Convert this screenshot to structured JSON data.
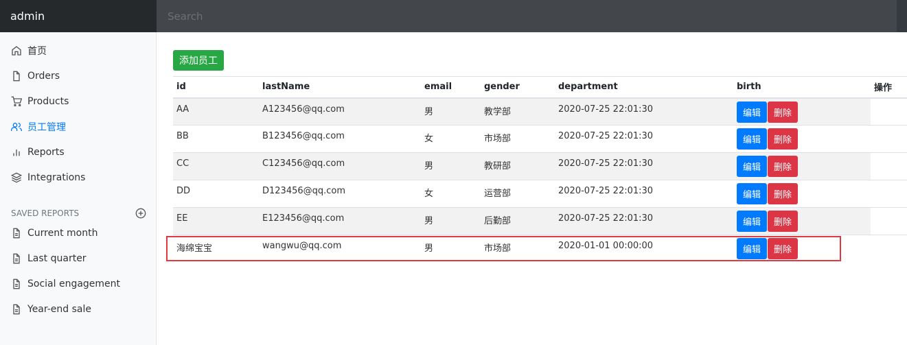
{
  "header": {
    "brand": "admin",
    "search_placeholder": "Search"
  },
  "sidebar": {
    "items": [
      {
        "label": "首页",
        "icon": "home-icon"
      },
      {
        "label": "Orders",
        "icon": "file-icon"
      },
      {
        "label": "Products",
        "icon": "cart-icon"
      },
      {
        "label": "员工管理",
        "icon": "users-icon",
        "active": true
      },
      {
        "label": "Reports",
        "icon": "bar-chart-icon"
      },
      {
        "label": "Integrations",
        "icon": "layers-icon"
      }
    ],
    "saved_heading": "SAVED REPORTS",
    "saved": [
      {
        "label": "Current month"
      },
      {
        "label": "Last quarter"
      },
      {
        "label": "Social engagement"
      },
      {
        "label": "Year-end sale"
      }
    ]
  },
  "main": {
    "add_button": "添加员工",
    "columns": [
      "id",
      "lastName",
      "email",
      "gender",
      "department",
      "birth",
      "操作"
    ],
    "rows": [
      {
        "c1": "AA",
        "c2": "A123456@qq.com",
        "c3": "男",
        "c4": "教学部",
        "c5": "2020-07-25 22:01:30"
      },
      {
        "c1": "BB",
        "c2": "B123456@qq.com",
        "c3": "女",
        "c4": "市场部",
        "c5": "2020-07-25 22:01:30"
      },
      {
        "c1": "CC",
        "c2": "C123456@qq.com",
        "c3": "男",
        "c4": "教研部",
        "c5": "2020-07-25 22:01:30"
      },
      {
        "c1": "DD",
        "c2": "D123456@qq.com",
        "c3": "女",
        "c4": "运营部",
        "c5": "2020-07-25 22:01:30"
      },
      {
        "c1": "EE",
        "c2": "E123456@qq.com",
        "c3": "男",
        "c4": "后勤部",
        "c5": "2020-07-25 22:01:30"
      },
      {
        "c1": "海绵宝宝",
        "c2": "wangwu@qq.com",
        "c3": "男",
        "c4": "市场部",
        "c5": "2020-01-01 00:00:00"
      }
    ],
    "edit_label": "编辑",
    "delete_label": "删除"
  },
  "colors": {
    "primary": "#007bff",
    "success": "#28a745",
    "danger": "#dc3545",
    "highlight": "#e0393f",
    "navbar": "#343a40"
  }
}
